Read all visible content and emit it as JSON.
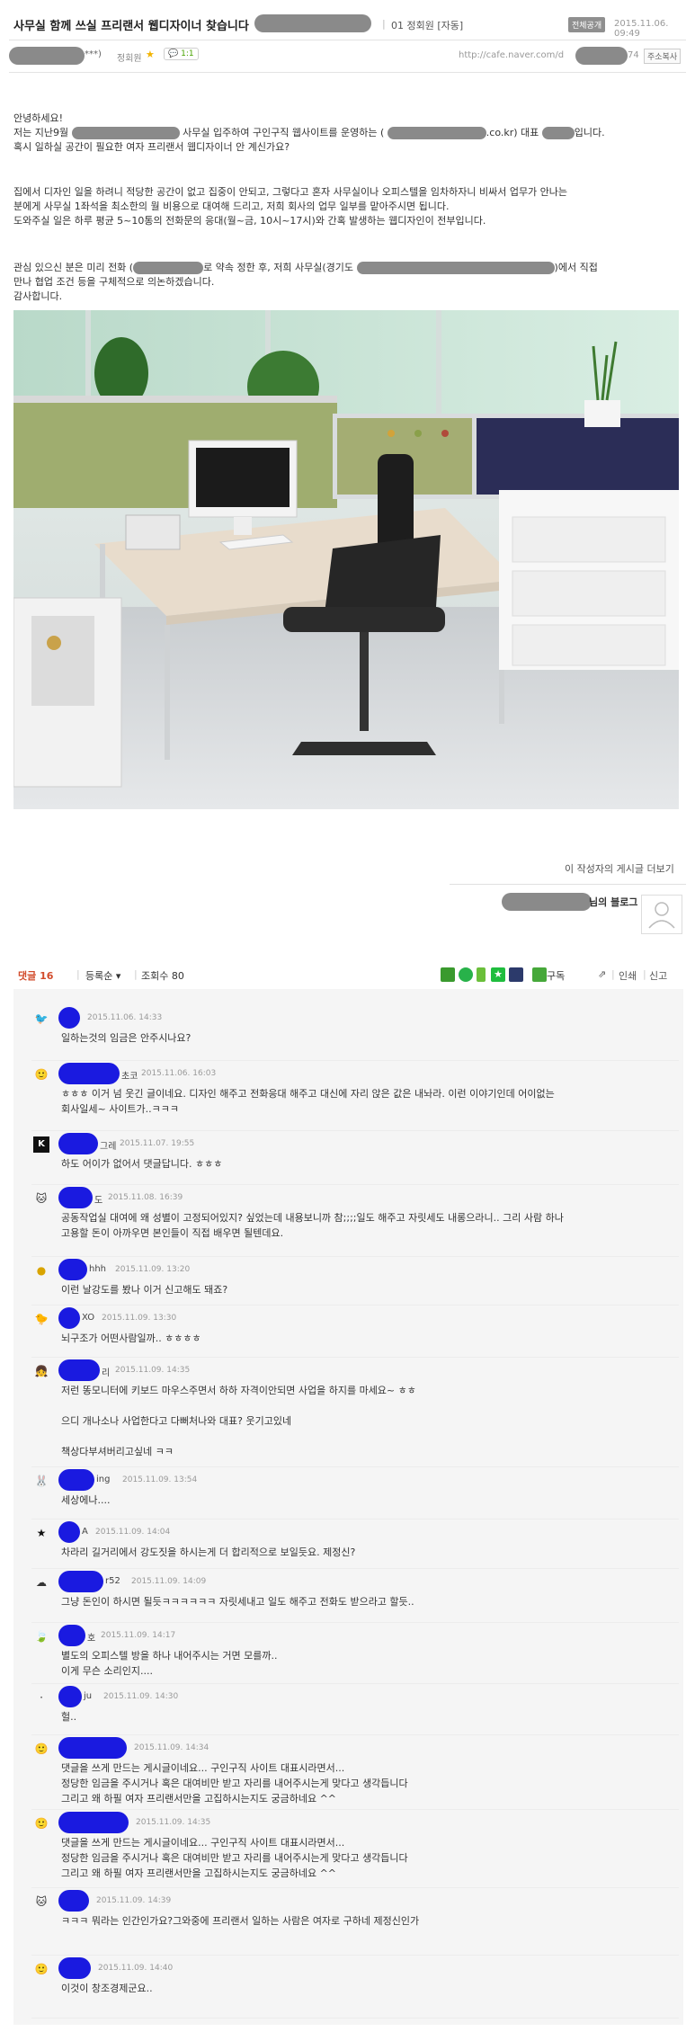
{
  "post": {
    "title": "사무실 함께 쓰실 프리랜서 웹디자이너 찾습니다",
    "board": "01 정회원 [자동]",
    "visibility_badge": "전체공개",
    "date": "2015.11.06. 09:49",
    "author_suffix": "***)",
    "author_level": "정회원",
    "chat_badge": "1:1",
    "url": "http://cafe.naver.com/d",
    "url_suffix": "74",
    "address_copy": "주소복사",
    "body": {
      "greeting": "안녕하세요!",
      "p1_a": "저는 지난9월",
      "p1_b": "사무실 입주하여 구인구직 웹사이트를 운영하는 (",
      "p1_c": ".co.kr) 대표",
      "p1_d": "입니다.",
      "p1_line2": "혹시 일하실 공간이 필요한 여자 프리랜서 웹디자이너 안 계신가요?",
      "p2_line1": "집에서 디자인 일을 하려니 적당한 공간이 없고 집중이 안되고, 그렇다고 혼자 사무실이나 오피스텔을 임차하자니 비싸서 업무가 안나는",
      "p2_line2": "분에게 사무실 1좌석을 최소한의 월 비용으로 대여해 드리고, 저희 회사의 업무 일부를 맡아주시면 됩니다.",
      "p2_line3": "도와주실 일은 하루 평균 5~10통의 전화문의 응대(월~금, 10시~17시)와 간혹 발생하는 웹디자인이 전부입니다.",
      "p3_a": "관심 있으신 분은 미리 전화 (",
      "p3_b": "로 약속 정한 후, 저희 사무실(경기도",
      "p3_c": ")에서 직접",
      "p3_line2": "만나 협업 조건 등을 구체적으로 의논하겠습니다.",
      "p3_line3": "감사합니다."
    }
  },
  "more_posts": "이 작성자의 게시글 더보기",
  "blog_suffix": "님의 블로그",
  "comment_bar": {
    "label": "댓글",
    "count": "16",
    "sort": "등록순",
    "views_label": "조회수",
    "views": "80",
    "subscribe": "구독",
    "print": "인쇄",
    "report": "신고"
  },
  "comments": [
    {
      "author_tail": "",
      "date": "2015.11.06. 14:33",
      "text": "일하는것의 임금은 안주시나요?",
      "avatar_icon": "bird-avatar-icon"
    },
    {
      "author_tail": "초코",
      "date": "2015.11.06. 16:03",
      "text": "ㅎㅎㅎ 이거 넘 웃긴 글이네요. 디자인 해주고 전화응대 해주고 대신에 자리 앉은 값은 내놔라. 이런 이야기인데 어이없는\n회사일세~ 사이트가..ㅋㅋㅋ",
      "avatar_icon": "face-avatar-icon"
    },
    {
      "author_tail": "그레",
      "date": "2015.11.07. 19:55",
      "text": "하도 어이가 없어서 댓글답니다. ㅎㅎㅎ",
      "avatar_icon": "k-avatar-icon"
    },
    {
      "author_tail": "도",
      "date": "2015.11.08. 16:39",
      "text": " 공동작업실 대여에 왜 성별이 고정되어있지? 싶었는데 내용보니까 참;;;;일도 해주고 자릿세도 내롱으라니.. 그리 사람 하나\n고용할 돈이 아까우면 본인들이 직접 배우면 될텐데요.",
      "avatar_icon": "cat-avatar-icon"
    },
    {
      "author_tail": "hhh",
      "date": "2015.11.09. 13:20",
      "text": "이런 날강도를 봤나 이거 신고해도 돼죠?",
      "avatar_icon": "egg-avatar-icon"
    },
    {
      "author_tail": "XO",
      "date": "2015.11.09. 13:30",
      "text": "뇌구조가 어떤사람일까.. ㅎㅎㅎㅎ",
      "avatar_icon": "chick-avatar-icon"
    },
    {
      "author_tail": "리",
      "date": "2015.11.09. 14:35",
      "text": "저런 똥모니터에 키보드 마우스주면서 하하 자격이안되면 사업을 하지를 마세요~ ㅎㅎ\n\n으디 개나소나 사업한다고 다뻐처나와 대표? 웃기고있네\n\n책상다부셔버리고싶네 ㅋㅋ",
      "avatar_icon": "girl-avatar-icon"
    },
    {
      "author_tail": "ing",
      "date": "2015.11.09. 13:54",
      "text": "세상에나....",
      "avatar_icon": "bunny-avatar-icon"
    },
    {
      "author_tail": "A",
      "date": "2015.11.09. 14:04",
      "text": "차라리 길거리에서 강도짓을 하시는게 더 합리적으로 보일듯요. 제정신?",
      "avatar_icon": "star-avatar-icon"
    },
    {
      "author_tail": "r52",
      "date": "2015.11.09. 14:09",
      "text": "그냥 돈인이 하시면 될듯ㅋㅋㅋㅋㅋㅋ 자릿세내고 일도 해주고 전화도 받으라고 할듯..",
      "avatar_icon": "cloud-avatar-icon"
    },
    {
      "author_tail": "호",
      "date": "2015.11.09. 14:17",
      "text": "별도의 오피스텔 방을 하나 내어주시는 거면 모를까..\n이게 무슨 소리인지....",
      "avatar_icon": "leaf-avatar-icon"
    },
    {
      "author_tail": "ju",
      "date": "2015.11.09. 14:30",
      "text": "헐..",
      "avatar_icon": "dot-avatar-icon"
    },
    {
      "author_tail": "",
      "date": "2015.11.09. 14:34",
      "text": "댓글을 쓰게 만드는 게시글이네요... 구인구직 사이트 대표시라면서...\n정당한 임금을 주시거나 혹은 대여비만 받고 자리를 내어주시는게 맞다고 생각듭니다\n그리고 왜 하필 여자 프리랜서만을 고집하시는지도 궁금하네요 ^^",
      "avatar_icon": "face2-avatar-icon"
    },
    {
      "author_tail": "",
      "date": "2015.11.09. 14:35",
      "text": "댓글을 쓰게 만드는 게시글이네요... 구인구직 사이트 대표시라면서...\n정당한 임금을 주시거나 혹은 대여비만 받고 자리를 내어주시는게 맞다고 생각듭니다\n그리고 왜 하필 여자 프리랜서만을 고집하시는지도 궁금하네요 ^^",
      "avatar_icon": "face3-avatar-icon"
    },
    {
      "author_tail": "",
      "date": "2015.11.09. 14:39",
      "text": "ㅋㅋㅋ 뭐라는 인간인가요?그와중에 프리랜서 일하는 사람은 여자로 구하네 제정신인가",
      "avatar_icon": "cat2-avatar-icon"
    },
    {
      "author_tail": "",
      "date": "2015.11.09. 14:40",
      "text": "이것이 창조경제군요..",
      "avatar_icon": "face4-avatar-icon"
    }
  ]
}
